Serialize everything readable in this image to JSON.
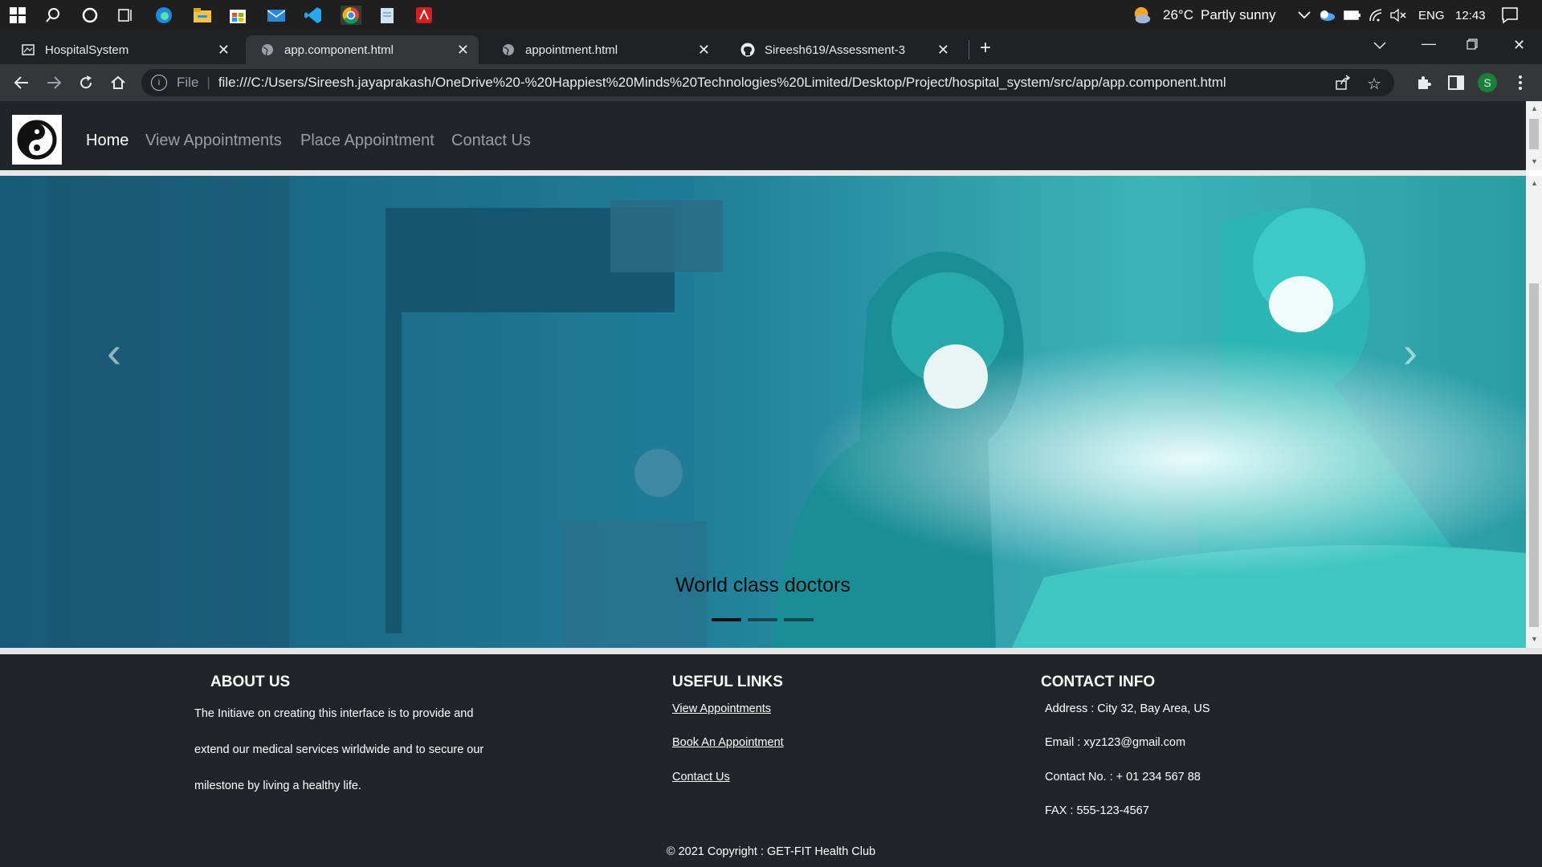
{
  "taskbar": {
    "weather_temp": "26°C",
    "weather_text": "Partly sunny",
    "language": "ENG",
    "time": "12:43"
  },
  "tabs": [
    {
      "title": "HospitalSystem",
      "icon": "document-icon"
    },
    {
      "title": "app.component.html",
      "icon": "globe-icon"
    },
    {
      "title": "appointment.html",
      "icon": "globe-icon"
    },
    {
      "title": "Sireesh619/Assessment-3",
      "icon": "github-icon"
    }
  ],
  "address_bar": {
    "scheme_label": "File",
    "url": "file:///C:/Users/Sireesh.jayaprakash/OneDrive%20-%20Happiest%20Minds%20Technologies%20Limited/Desktop/Project/hospital_system/src/app/app.component.html"
  },
  "profile_initial": "S",
  "nav": {
    "items": [
      "Home",
      "View Appointments",
      "Place Appointment",
      "Contact Us"
    ]
  },
  "carousel": {
    "caption": "World class doctors"
  },
  "footer": {
    "about": {
      "title": "ABOUT US",
      "lines": [
        "The Initiave on creating this interface is to provide and",
        "extend our medical services wirldwide and to secure our",
        "milestone by living a healthy life."
      ]
    },
    "links": {
      "title": "USEFUL LINKS",
      "items": [
        "View Appointments",
        "Book An Appointment",
        "Contact Us"
      ]
    },
    "contact": {
      "title": "CONTACT INFO",
      "address": "Address : City 32, Bay Area, US",
      "email": "Email : xyz123@gmail.com",
      "phone": "Contact No. : + 01 234 567 88",
      "fax": "FAX : 555-123-4567"
    },
    "copyright": "© 2021 Copyright : GET-FIT Health Club"
  },
  "colors": {
    "navbar": "#212529",
    "footer": "#212529",
    "hero_teal": "#1fb7b5"
  }
}
